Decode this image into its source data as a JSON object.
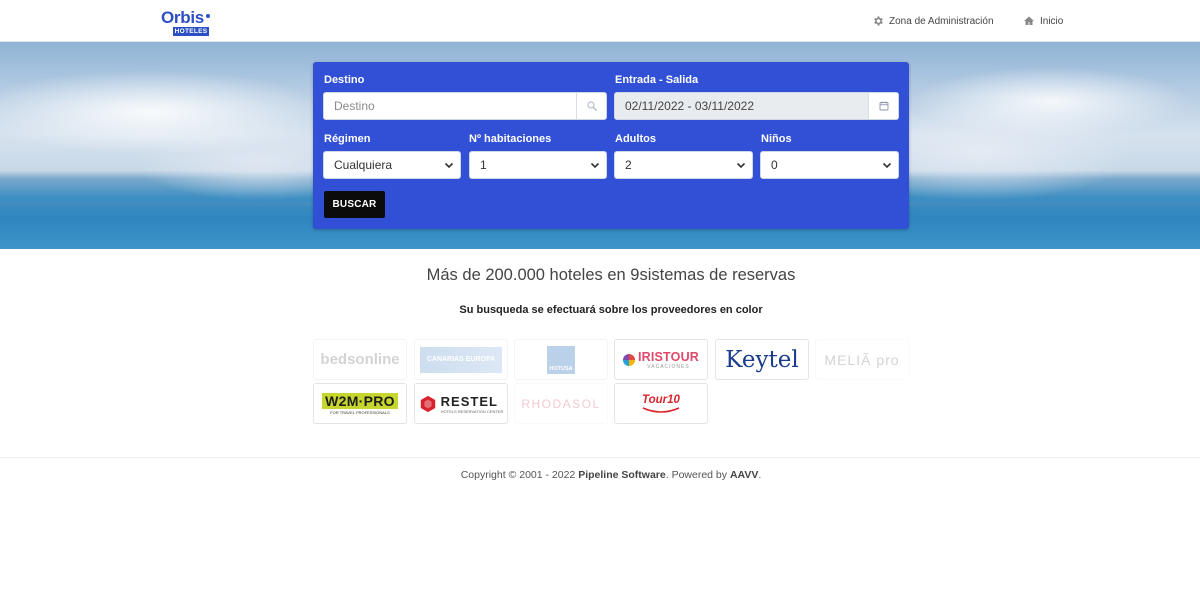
{
  "header": {
    "logo_text": "Orbis",
    "logo_badge": "HOTELES",
    "nav": {
      "admin_label": "Zona de Administración",
      "home_label": "Inicio"
    }
  },
  "search": {
    "destino_label": "Destino",
    "destino_placeholder": "Destino",
    "dates_label": "Entrada  -  Salida",
    "dates_value": "02/11/2022  -  03/11/2022",
    "regimen_label": "Régimen",
    "regimen_value": "Cualquiera",
    "habitaciones_label": "Nº habitaciones",
    "habitaciones_value": "1",
    "adultos_label": "Adultos",
    "adultos_value": "2",
    "ninos_label": "Niños",
    "ninos_value": "0",
    "button_label": "BUSCAR"
  },
  "content": {
    "headline": "Más de 200.000 hoteles en 9sistemas de reservas",
    "subline": "Su busqueda se efectuará sobre los proveedores en color"
  },
  "providers": [
    {
      "name": "bedsonline",
      "active": false
    },
    {
      "name": "CANARIAS EUROPA",
      "active": false
    },
    {
      "name": "HOTUSA",
      "active": false
    },
    {
      "name": "IRISTOUR",
      "sub": "VACACIONES",
      "active": true
    },
    {
      "name": "Keytel",
      "active": true
    },
    {
      "name": "MELIÃ pro",
      "active": false
    },
    {
      "name": "W2M·PRO",
      "sub": "FOR TRAVEL PROFESSIONALS",
      "active": true
    },
    {
      "name": "RESTEL",
      "sub": "HOTELS RESERVATION CENTER",
      "active": true
    },
    {
      "name": "RHODASOL",
      "active": false
    },
    {
      "name": "Tour10",
      "active": true
    }
  ],
  "footer": {
    "prefix": "Copyright © 2001 - 2022 ",
    "company": "Pipeline Software",
    "middle": ". Powered by ",
    "powered": "AAVV",
    "suffix": "."
  },
  "colors": {
    "brand_blue": "#2c4fc4",
    "panel_blue": "#3150d6",
    "button_black": "#0b0b0b"
  }
}
